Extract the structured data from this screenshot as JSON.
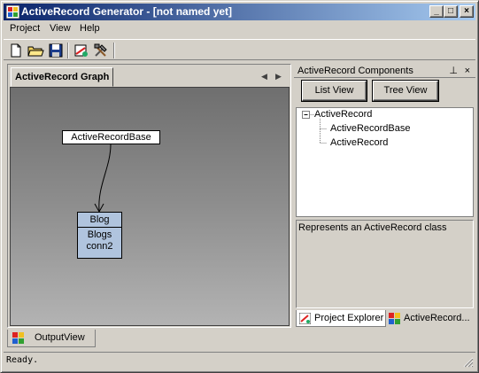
{
  "window": {
    "title": "ActiveRecord Generator - [not named yet]"
  },
  "menu": [
    "Project",
    "View",
    "Help"
  ],
  "toolbar": {
    "icons": [
      "new-file-icon",
      "open-folder-icon",
      "save-icon",
      "generate-code-icon",
      "build-tools-icon"
    ]
  },
  "graph": {
    "tab_label": "ActiveRecord Graph",
    "base_node": "ActiveRecordBase",
    "blog_node": {
      "title": "Blog",
      "lines": [
        "Blogs",
        "conn2"
      ]
    }
  },
  "components": {
    "title": "ActiveRecord Components",
    "pin": "ᵖ",
    "close": "×",
    "list_view": "List View",
    "tree_view": "Tree View",
    "tree": {
      "root": "ActiveRecord",
      "children": [
        "ActiveRecordBase",
        "ActiveRecord"
      ]
    },
    "description": "Represents an ActiveRecord class",
    "bottom_tabs": [
      "Project Explorer",
      "ActiveRecord..."
    ]
  },
  "output_tab": "OutputView",
  "status": "Ready.",
  "colors": {
    "titlebar_start": "#0a246a",
    "titlebar_end": "#a6caf0",
    "node_fill": "#b0c4de"
  }
}
